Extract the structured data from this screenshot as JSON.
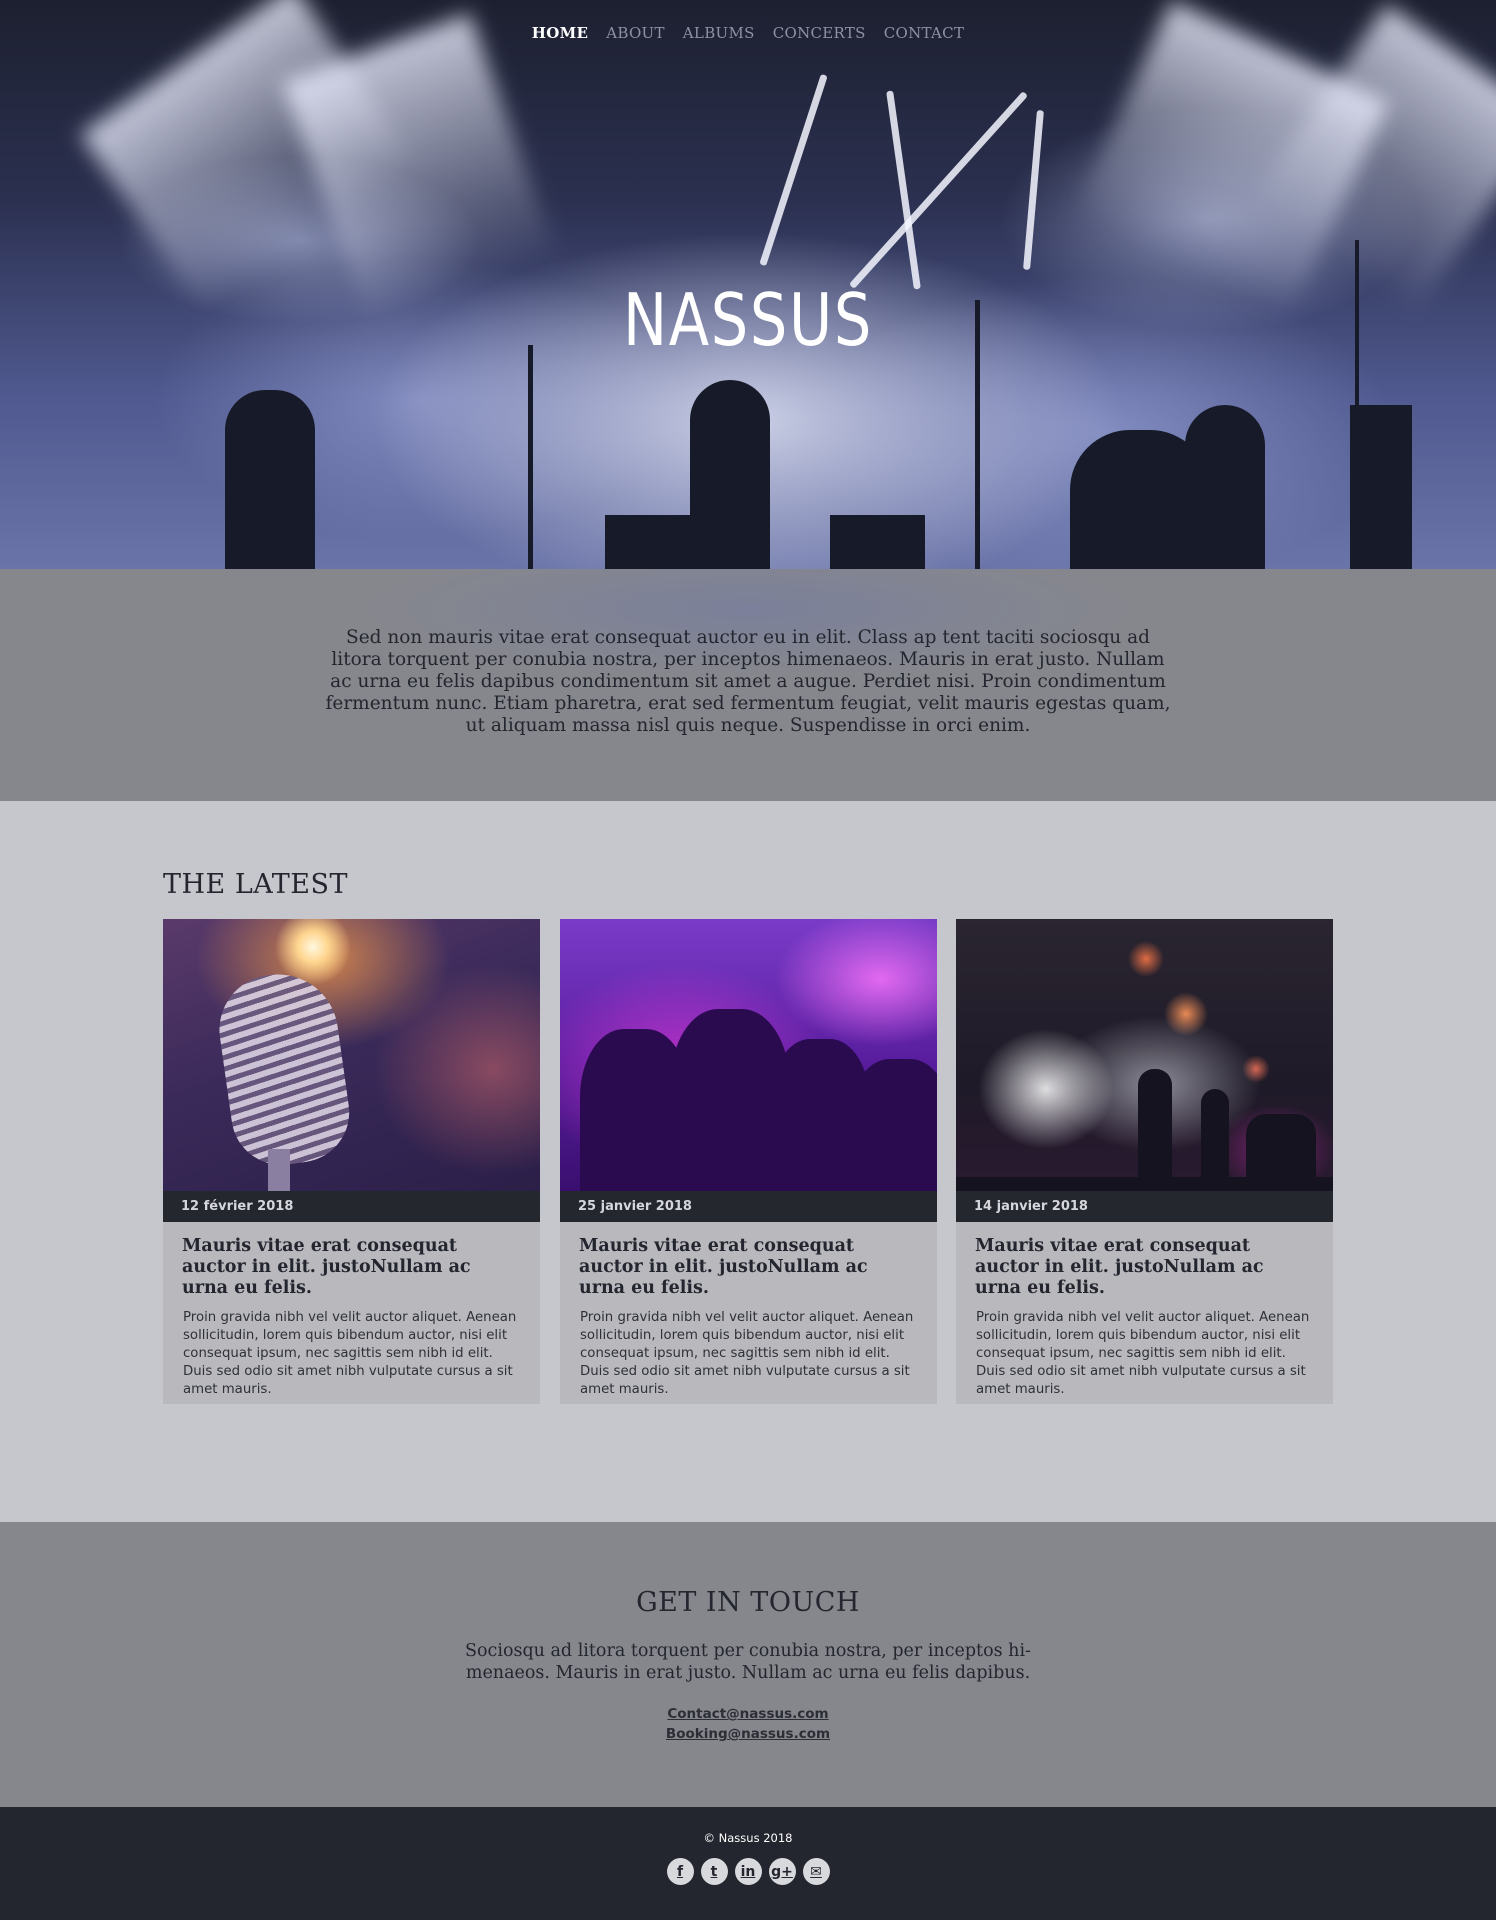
{
  "nav": {
    "items": [
      {
        "label": "HOME",
        "active": true
      },
      {
        "label": "ABOUT",
        "active": false
      },
      {
        "label": "ALBUMS",
        "active": false
      },
      {
        "label": "CONCERTS",
        "active": false
      },
      {
        "label": "CONTACT",
        "active": false
      }
    ]
  },
  "hero": {
    "logo": "NASSUS"
  },
  "intro": {
    "text": "Sed non  mauris vitae erat consequat auctor eu in elit. Class ap tent taciti sociosqu ad litora torquent per conubia nostra, per inceptos himenaeos. Mauris in erat justo. Nullam ac urna eu felis dapibus condimentum sit amet a augue. Perdiet nisi. Proin condimentum fermentum nunc. Etiam pharetra, erat sed fermentum feugiat, velit mauris egestas quam, ut aliquam massa nisl quis neque. Suspendisse in orci enim."
  },
  "latest": {
    "heading": "THE LATEST",
    "cards": [
      {
        "image": "microphone-photo",
        "date": "12 février 2018",
        "title": "Mauris vitae erat consequat auctor in elit. justoNullam ac urna eu felis.",
        "body": "Proin gravida nibh vel velit auctor aliquet. Aenean sollicitudin, lorem quis bibendum auctor, nisi elit consequat ipsum, nec sagittis sem nibh id elit. Duis sed odio sit amet nibh vulputate cursus a sit amet mauris."
      },
      {
        "image": "crowd-photo",
        "date": "25 janvier 2018",
        "title": "Mauris vitae erat consequat auctor in elit. justoNullam ac urna eu felis.",
        "body": "Proin gravida nibh vel velit auctor aliquet. Aenean sollicitudin, lorem quis bibendum auctor, nisi elit consequat ipsum, nec sagittis sem nibh id elit. Duis sed odio sit amet nibh vulputate cursus a sit amet mauris."
      },
      {
        "image": "stage-photo",
        "date": "14 janvier 2018",
        "title": "Mauris vitae erat consequat auctor in elit. justoNullam ac urna eu felis.",
        "body": "Proin gravida nibh vel velit auctor aliquet. Aenean sollicitudin, lorem quis bibendum auctor, nisi elit consequat ipsum, nec sagittis sem nibh id elit. Duis sed odio sit amet nibh vulputate cursus a sit amet mauris."
      }
    ]
  },
  "contact": {
    "heading": "GET IN TOUCH",
    "text": "Sociosqu ad litora torquent per conubia nostra, per inceptos hi-menaeos. Mauris in erat justo. Nullam ac urna eu felis dapibus.",
    "email_contact": "Contact@nassus.com",
    "email_booking": "Booking@nassus.com"
  },
  "footer": {
    "copyright": "© Nassus 2018",
    "socials": [
      {
        "icon": "facebook-icon",
        "glyph": "f"
      },
      {
        "icon": "twitter-icon",
        "glyph": "t"
      },
      {
        "icon": "linkedin-icon",
        "glyph": "in"
      },
      {
        "icon": "google-plus-icon",
        "glyph": "g+"
      },
      {
        "icon": "mail-icon",
        "glyph": "✉"
      }
    ]
  },
  "colors": {
    "dark": "#23262f",
    "band_gray": "#86878d",
    "light_gray": "#c6c7cc",
    "card_bg": "#b8b8bd"
  }
}
